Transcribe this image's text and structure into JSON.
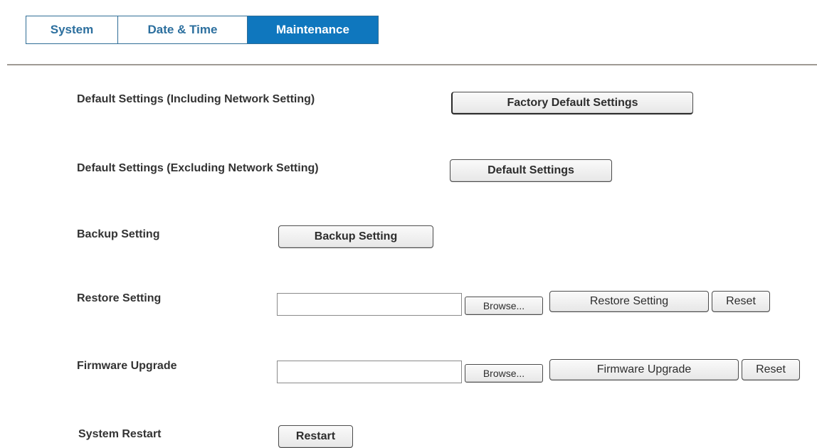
{
  "tabs": [
    {
      "label": "System",
      "active": false
    },
    {
      "label": "Date & Time",
      "active": false
    },
    {
      "label": "Maintenance",
      "active": true
    }
  ],
  "colors": {
    "tab_active_bg": "#0f77be",
    "tab_text": "#2c6f9e",
    "divider": "#9f9a94"
  },
  "maintenance": {
    "factory_default": {
      "label": "Default Settings (Including Network Setting)",
      "button": "Factory Default Settings"
    },
    "default_settings": {
      "label": "Default Settings (Excluding Network Setting)",
      "button": "Default Settings"
    },
    "backup": {
      "label": "Backup Setting",
      "button": "Backup Setting"
    },
    "restore": {
      "label": "Restore Setting",
      "file_value": "",
      "browse_button": "Browse...",
      "action_button": "Restore Setting",
      "reset_button": "Reset"
    },
    "firmware": {
      "label": "Firmware Upgrade",
      "file_value": "",
      "browse_button": "Browse...",
      "action_button": "Firmware Upgrade",
      "reset_button": "Reset"
    },
    "restart": {
      "label": "System Restart",
      "button": "Restart"
    }
  }
}
